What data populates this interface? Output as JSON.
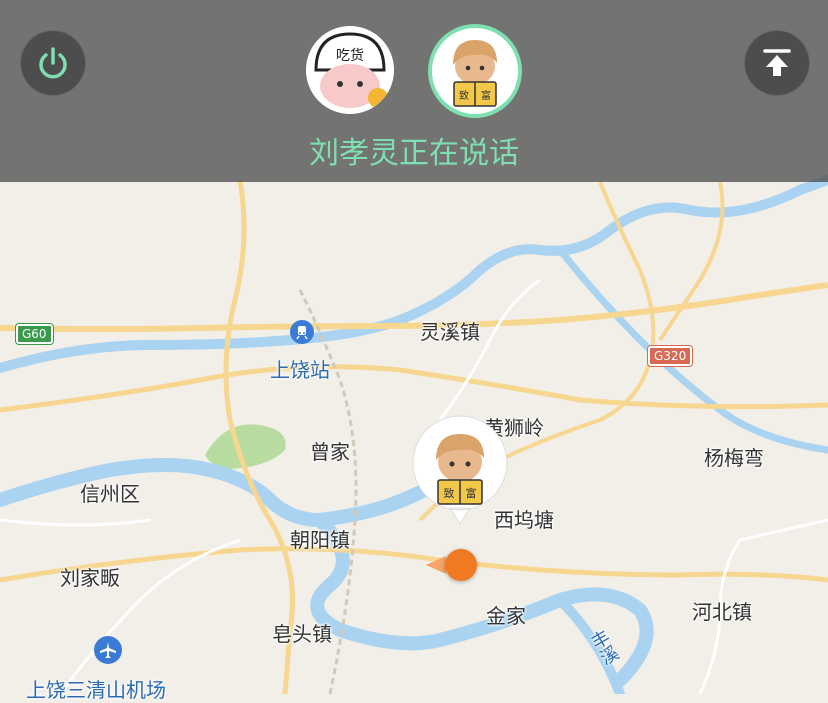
{
  "header": {
    "speaking_text": "刘孝灵正在说话",
    "avatar_left_badge": "吃货",
    "avatar_right_book": "致富"
  },
  "map": {
    "places": {
      "lingxi": "灵溪镇",
      "shangrao_station": "上饶站",
      "huangshiling": "黄狮岭",
      "zengjia": "曾家",
      "yangmeiwan": "杨梅弯",
      "xinzhou": "信州区",
      "xiwutang": "西坞塘",
      "chaoyang": "朝阳镇",
      "liujiafan": "刘家畈",
      "jinjia": "金家",
      "hebei": "河北镇",
      "zaotou": "皂头镇",
      "airport": "上饶三清山机场",
      "fengxi": "丰溪"
    },
    "shields": {
      "g60": "G60",
      "g320": "G320"
    }
  },
  "colors": {
    "accent": "#7ee0b0",
    "marker": "#f07a22",
    "water": "#a9d3f0",
    "road": "#f7d690"
  }
}
